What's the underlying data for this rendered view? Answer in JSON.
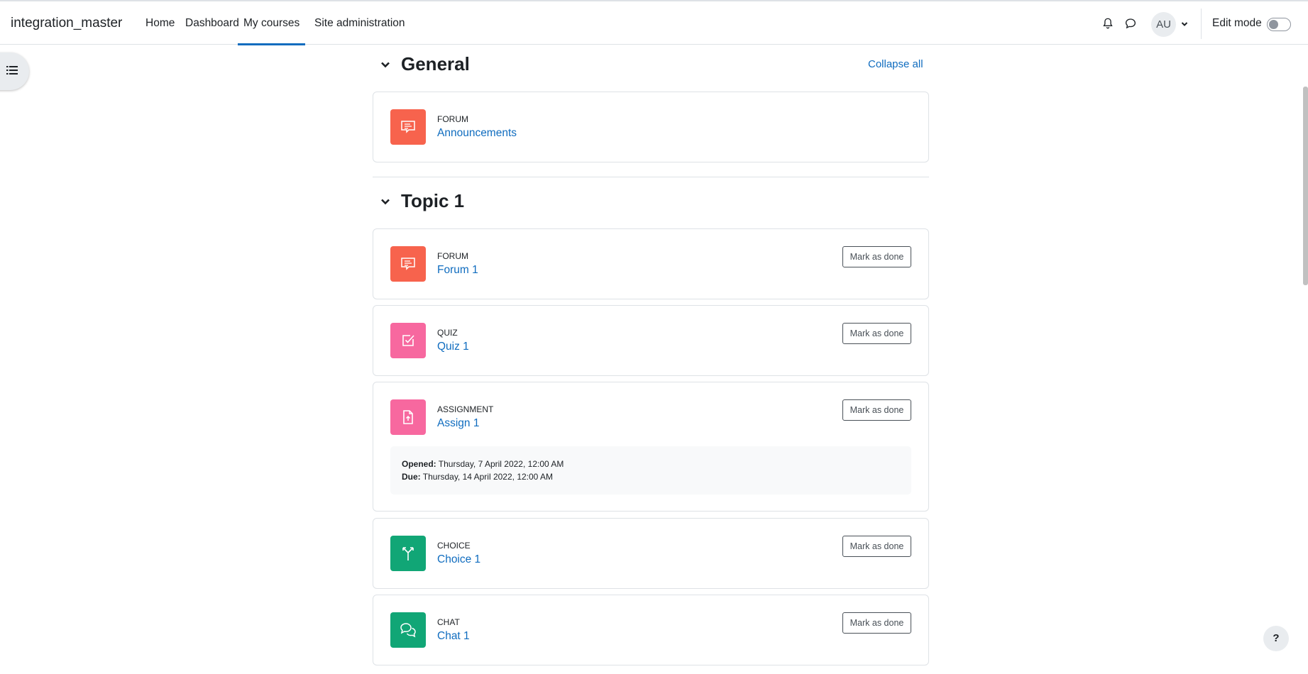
{
  "navbar": {
    "brand": "integration_master",
    "links": [
      "Home",
      "Dashboard",
      "My courses",
      "Site administration"
    ],
    "active_link": "My courses",
    "user_initials": "AU",
    "edit_mode_label": "Edit mode",
    "edit_mode_on": false
  },
  "sections": [
    {
      "title": "General",
      "collapse_all_label": "Collapse all",
      "activities": [
        {
          "type": "FORUM",
          "name": "Announcements",
          "icon": "forum-icon",
          "color": "#f7634d"
        }
      ]
    },
    {
      "title": "Topic 1",
      "activities": [
        {
          "type": "FORUM",
          "name": "Forum 1",
          "icon": "forum-icon",
          "color": "#f7634d",
          "button": "Mark as done"
        },
        {
          "type": "QUIZ",
          "name": "Quiz 1",
          "icon": "quiz-icon",
          "color": "#f7689f",
          "button": "Mark as done"
        },
        {
          "type": "ASSIGNMENT",
          "name": "Assign 1",
          "icon": "assignment-icon",
          "color": "#f7689f",
          "button": "Mark as done",
          "opened_label": "Opened:",
          "opened_value": "Thursday, 7 April 2022, 12:00 AM",
          "due_label": "Due:",
          "due_value": "Thursday, 14 April 2022, 12:00 AM"
        },
        {
          "type": "CHOICE",
          "name": "Choice 1",
          "icon": "choice-icon",
          "color": "#11a676",
          "button": "Mark as done"
        },
        {
          "type": "CHAT",
          "name": "Chat 1",
          "icon": "chat-icon",
          "color": "#11a676",
          "button": "Mark as done"
        }
      ]
    }
  ],
  "help_label": "?"
}
